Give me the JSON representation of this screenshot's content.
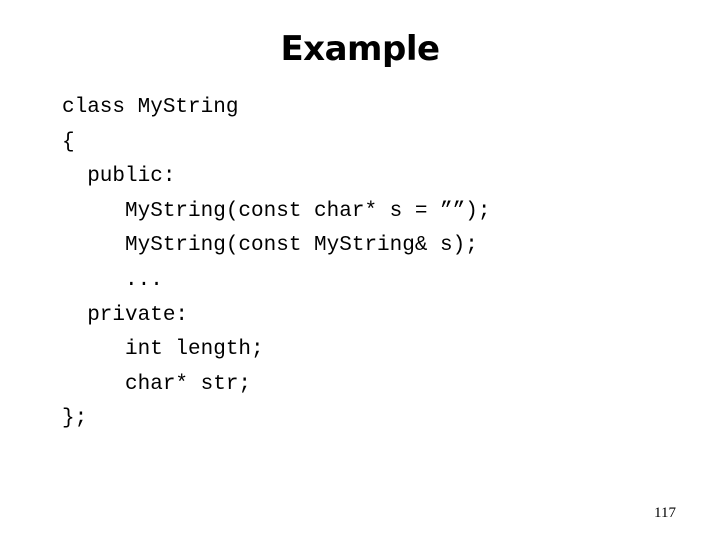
{
  "slide": {
    "title": "Example",
    "code_lines": [
      "class MyString",
      "{",
      "  public:",
      "     MyString(const char* s = ””);",
      "     MyString(const MyString& s);",
      "     ...",
      "  private:",
      "     int length;",
      "     char* str;",
      "};"
    ],
    "page_number": "117"
  }
}
